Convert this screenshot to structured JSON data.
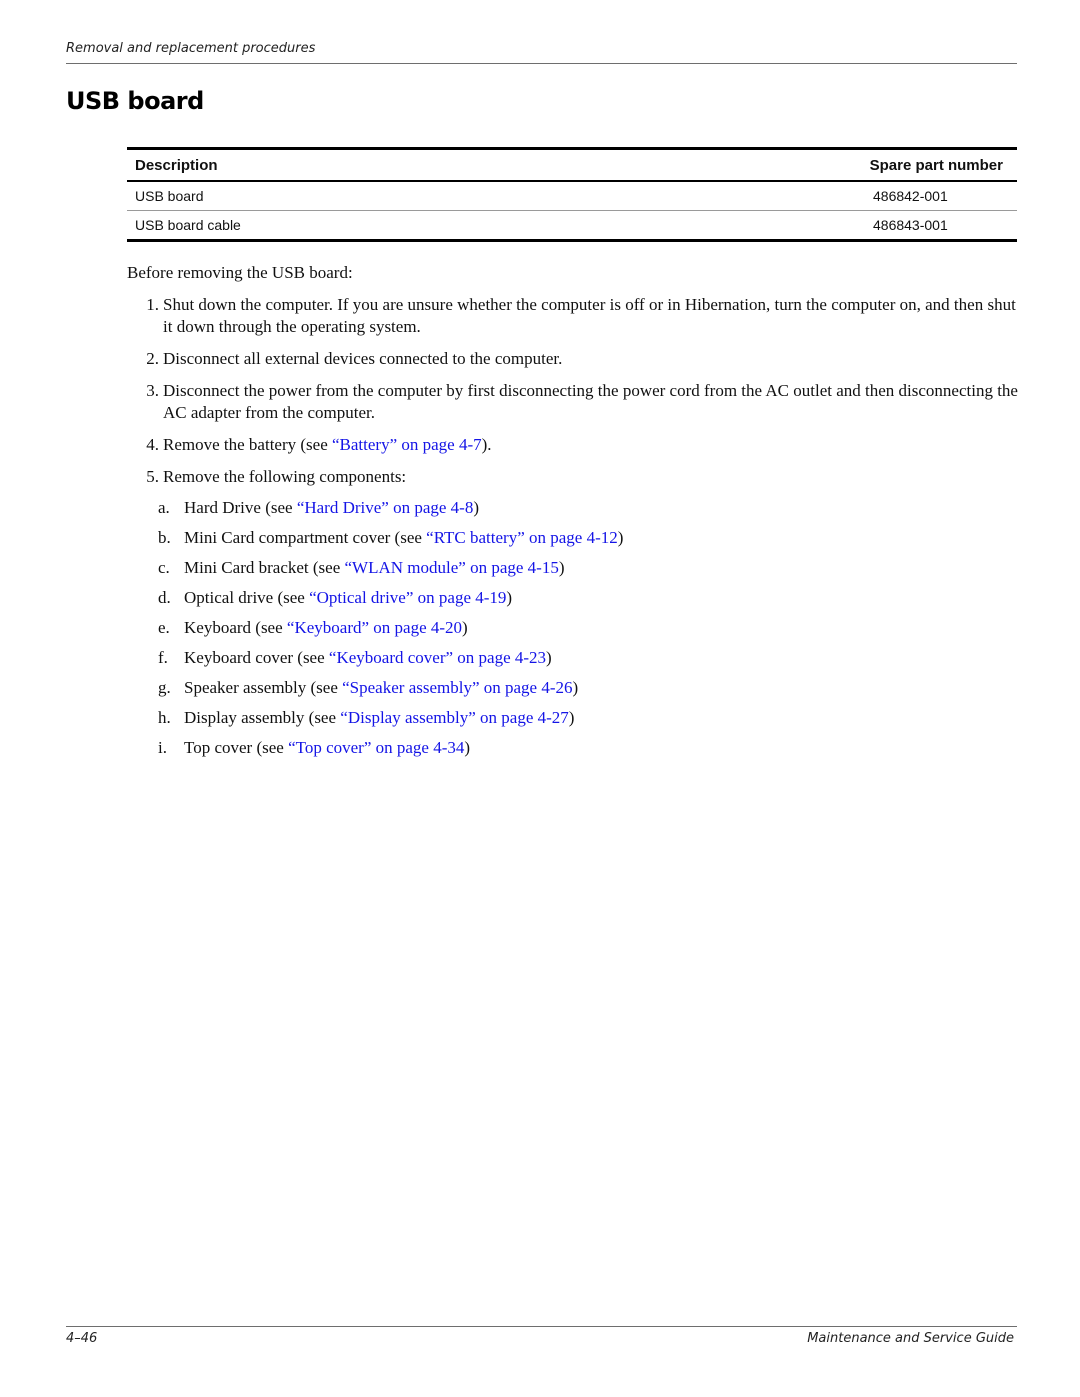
{
  "header": {
    "running_title": "Removal and replacement procedures"
  },
  "title": "USB board",
  "table": {
    "columns": [
      "Description",
      "Spare part number"
    ],
    "rows": [
      {
        "description": "USB board",
        "part_number": "486842-001"
      },
      {
        "description": "USB board cable",
        "part_number": "486843-001"
      }
    ]
  },
  "intro": "Before removing the USB board:",
  "steps": [
    {
      "num": "1.",
      "text": "Shut down the computer. If you are unsure whether the computer is off or in Hibernation, turn the computer on, and then shut it down through the operating system."
    },
    {
      "num": "2.",
      "text": "Disconnect all external devices connected to the computer."
    },
    {
      "num": "3.",
      "text": "Disconnect the power from the computer by first disconnecting the power cord from the AC outlet and then disconnecting the AC adapter from the computer."
    },
    {
      "num": "4.",
      "pre": "Remove the battery (see ",
      "link": "“Battery” on page 4-7",
      "post": ")."
    },
    {
      "num": "5.",
      "text": "Remove the following components:"
    }
  ],
  "components": [
    {
      "letter": "a.",
      "pre": "Hard Drive (see ",
      "link": "“Hard Drive” on page 4-8",
      "post": ")"
    },
    {
      "letter": "b.",
      "pre": "Mini Card compartment cover (see ",
      "link": "“RTC battery” on page 4-12",
      "post": ")"
    },
    {
      "letter": "c.",
      "pre": "Mini Card bracket (see ",
      "link": "“WLAN module” on page 4-15",
      "post": ")"
    },
    {
      "letter": "d.",
      "pre": "Optical drive (see ",
      "link": "“Optical drive” on page 4-19",
      "post": ")"
    },
    {
      "letter": "e.",
      "pre": "Keyboard (see ",
      "link": "“Keyboard” on page 4-20",
      "post": ")"
    },
    {
      "letter": "f.",
      "pre": "Keyboard cover (see ",
      "link": "“Keyboard cover” on page 4-23",
      "post": ")"
    },
    {
      "letter": "g.",
      "pre": "Speaker assembly (see ",
      "link": "“Speaker assembly” on page 4-26",
      "post": ")"
    },
    {
      "letter": "h.",
      "pre": "Display assembly (see ",
      "link": "“Display assembly” on page 4-27",
      "post": ")"
    },
    {
      "letter": "i.",
      "pre": "Top cover (see ",
      "link": "“Top cover” on page 4-34",
      "post": ")"
    }
  ],
  "footer": {
    "page_number": "4–46",
    "guide_title": "Maintenance and Service Guide"
  },
  "colors": {
    "link": "#1414e6",
    "rule": "#6e6e6e"
  }
}
